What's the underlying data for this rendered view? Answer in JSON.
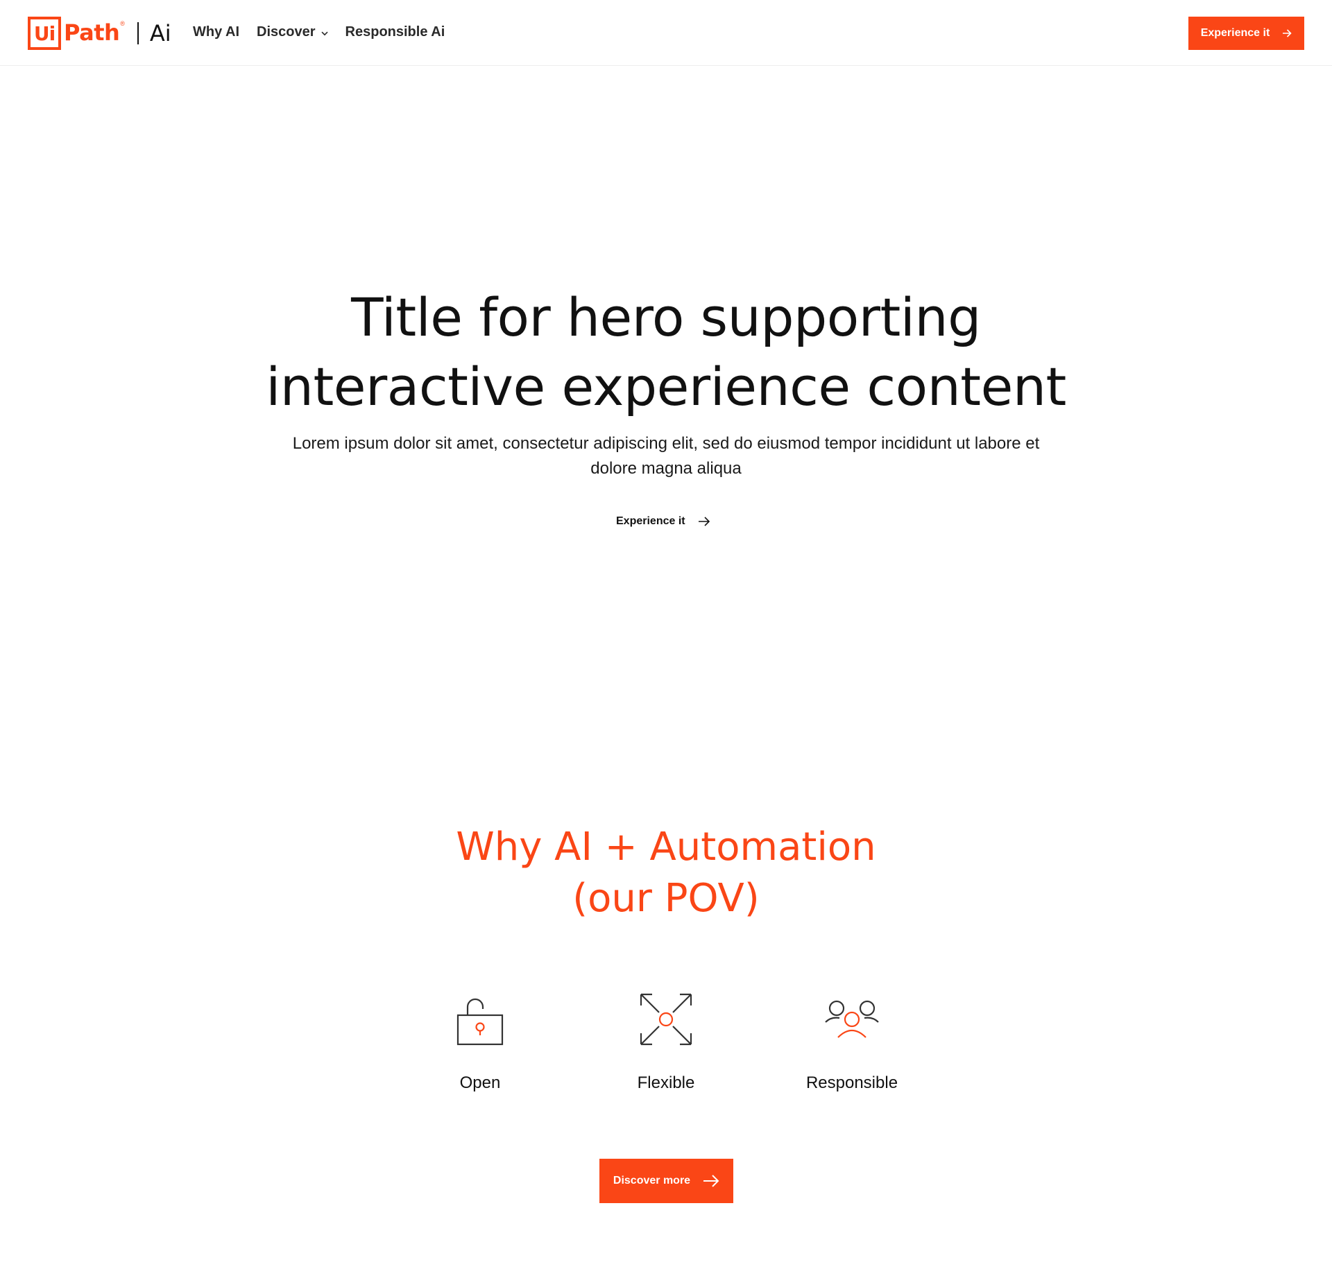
{
  "colors": {
    "accent": "#fa4616",
    "text": "#111111",
    "background": "#ffffff"
  },
  "header": {
    "logo": {
      "ui": "Ui",
      "path": "Path",
      "registered": "®",
      "product": "Ai"
    },
    "nav": [
      {
        "label": "Why AI"
      },
      {
        "label": "Discover",
        "icon": "chevron-down-icon"
      },
      {
        "label": "Responsible Ai"
      }
    ],
    "cta": {
      "label": "Experience it",
      "icon": "arrow-right-icon"
    }
  },
  "hero": {
    "title_lines": [
      "Title for hero supporting",
      "interactive experience content"
    ],
    "subtitle": "Lorem ipsum dolor sit amet, consectetur adipiscing elit, sed do eiusmod tempor incididunt ut labore et dolore magna aliqua",
    "link": {
      "label": "Experience it",
      "icon": "arrow-right-icon"
    }
  },
  "why": {
    "title_lines": [
      "Why AI + Automation",
      "(our POV)"
    ],
    "features": [
      {
        "label": "Open",
        "icon": "unlocked-padlock-icon"
      },
      {
        "label": "Flexible",
        "icon": "expand-arrows-icon"
      },
      {
        "label": "Responsible",
        "icon": "people-group-icon"
      }
    ],
    "cta": {
      "label": "Discover more",
      "icon": "arrow-right-icon"
    }
  }
}
